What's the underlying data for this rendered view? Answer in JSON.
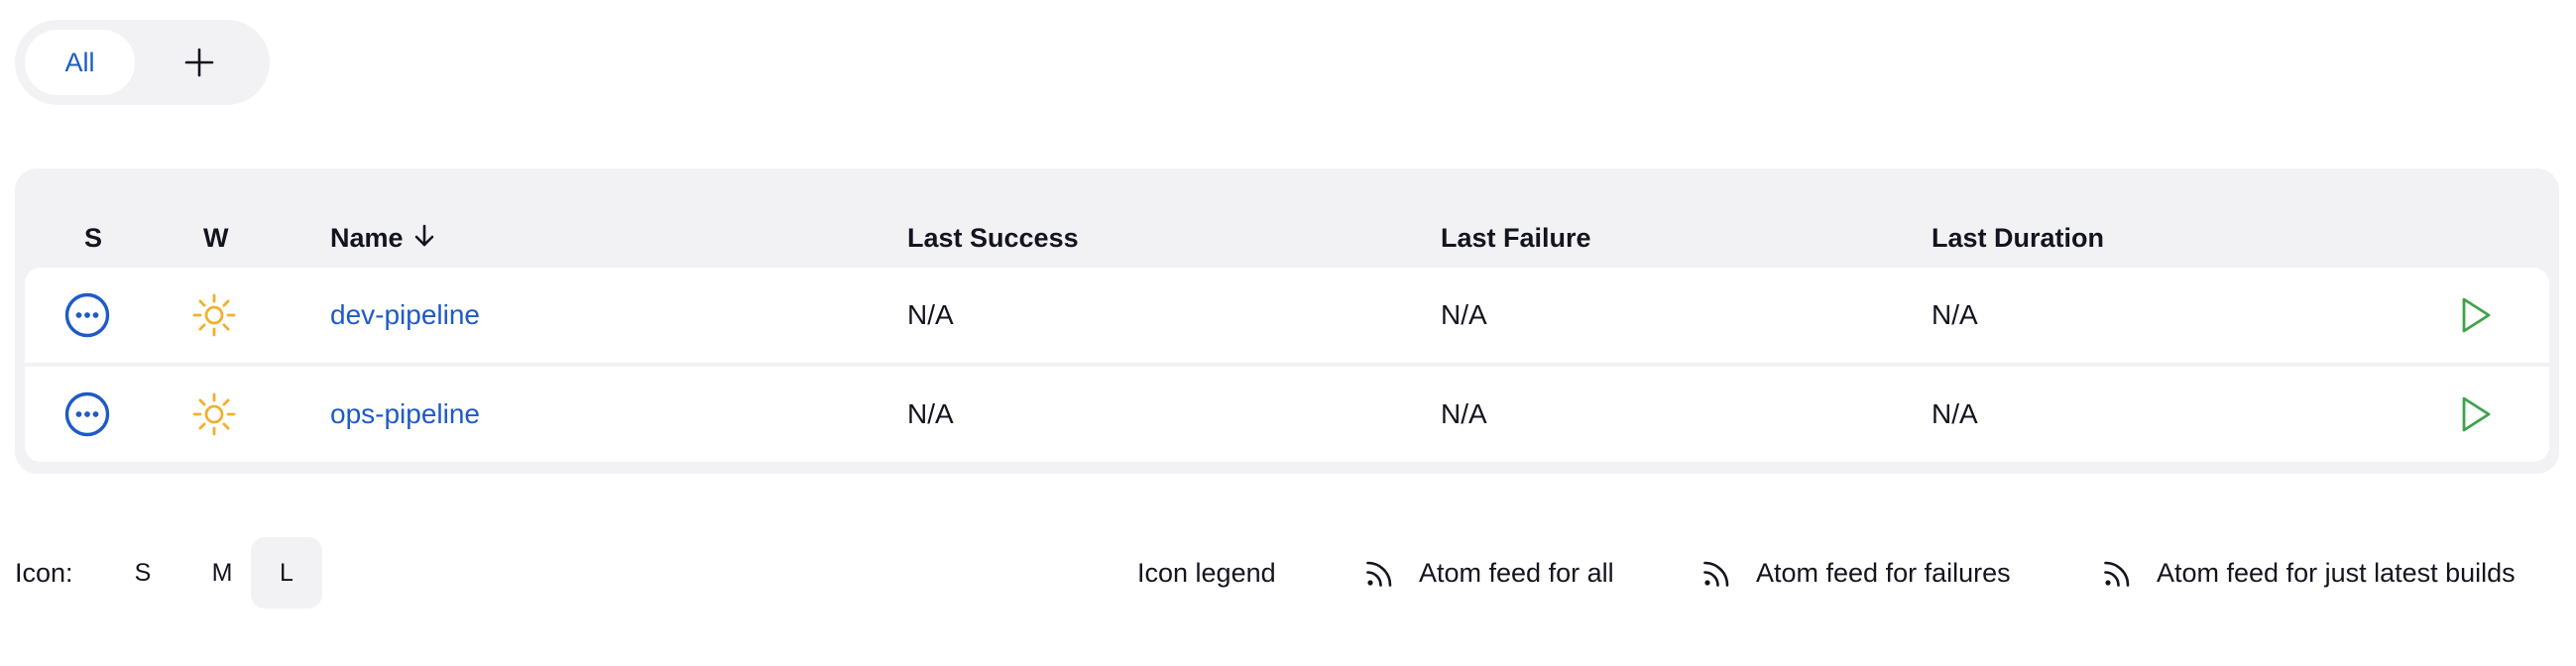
{
  "tabs": {
    "all_label": "All",
    "add_icon": "plus-icon"
  },
  "table": {
    "headers": {
      "status": "S",
      "weather": "W",
      "name": "Name",
      "name_sort_icon": "arrow-down-icon",
      "last_success": "Last Success",
      "last_failure": "Last Failure",
      "last_duration": "Last Duration"
    },
    "rows": [
      {
        "status_icon": "ellipsis-circle-icon",
        "weather_icon": "sun-icon",
        "name": "dev-pipeline",
        "last_success": "N/A",
        "last_failure": "N/A",
        "last_duration": "N/A",
        "build_icon": "play-icon"
      },
      {
        "status_icon": "ellipsis-circle-icon",
        "weather_icon": "sun-icon",
        "name": "ops-pipeline",
        "last_success": "N/A",
        "last_failure": "N/A",
        "last_duration": "N/A",
        "build_icon": "play-icon"
      }
    ]
  },
  "footer": {
    "icon_label": "Icon:",
    "sizes": [
      "S",
      "M",
      "L"
    ],
    "selected_size": "L",
    "links": {
      "legend": "Icon legend",
      "feed_all": "Atom feed for all",
      "feed_failures": "Atom feed for failures",
      "feed_latest": "Atom feed for just latest builds"
    },
    "feed_icon": "rss-icon"
  },
  "colors": {
    "link_blue": "#1e5ac8",
    "status_blue": "#1e5ac8",
    "weather_sun": "#f0b030",
    "build_green": "#3fa24a",
    "panel_gray": "#f2f2f5"
  }
}
